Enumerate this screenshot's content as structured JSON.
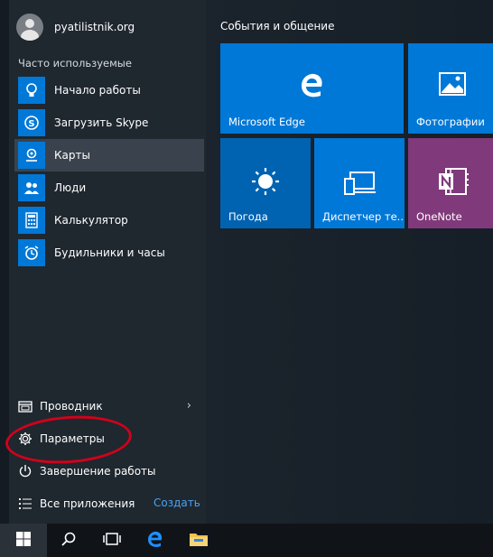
{
  "user": {
    "name": "pyatilistnik.org"
  },
  "left": {
    "section_title": "Часто используемые",
    "apps": [
      {
        "label": "Начало работы",
        "icon": "lightbulb-icon"
      },
      {
        "label": "Загрузить Skype",
        "icon": "skype-icon"
      },
      {
        "label": "Карты",
        "icon": "maps-icon"
      },
      {
        "label": "Люди",
        "icon": "people-icon"
      },
      {
        "label": "Калькулятор",
        "icon": "calculator-icon"
      },
      {
        "label": "Будильники и часы",
        "icon": "alarm-clock-icon"
      }
    ],
    "selected_index": 2,
    "bottom": [
      {
        "label": "Проводник",
        "icon": "file-explorer-icon"
      },
      {
        "label": "Параметры",
        "icon": "gear-icon"
      },
      {
        "label": "Завершение работы",
        "icon": "power-icon"
      }
    ],
    "all_apps": "Все приложения",
    "create": "Создать"
  },
  "tiles": {
    "group_title": "События и общение",
    "items": [
      {
        "label": "Microsoft Edge",
        "icon": "edge-icon",
        "color": "#0078d7"
      },
      {
        "label": "Фотографии",
        "icon": "photos-icon",
        "color": "#0078d7"
      },
      {
        "label": "Погода",
        "icon": "weather-sun-icon",
        "color": "#0063b1"
      },
      {
        "label": "Диспетчер те...",
        "icon": "phone-companion-icon",
        "color": "#0078d7"
      },
      {
        "label": "OneNote",
        "icon": "onenote-icon",
        "color": "#80397b"
      }
    ]
  },
  "taskbar": {
    "items": [
      "windows-logo-icon",
      "search-icon",
      "task-view-icon",
      "edge-icon",
      "file-explorer-icon"
    ]
  },
  "colors": {
    "accent": "#0078d7",
    "highlight_ring": "#d0021b",
    "link": "#4aa3f0"
  }
}
